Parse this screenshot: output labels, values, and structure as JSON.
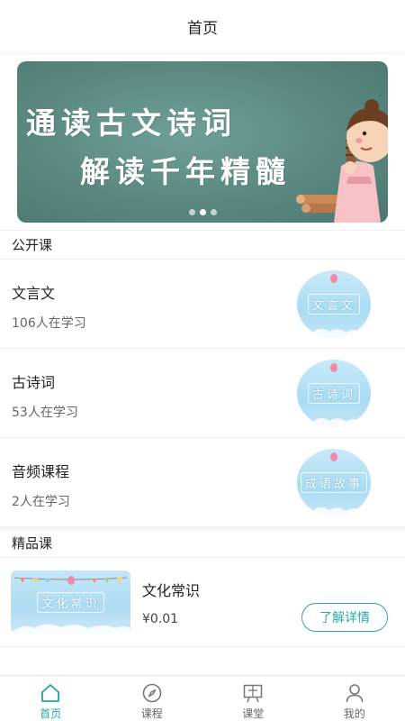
{
  "header": {
    "title": "首页"
  },
  "banner": {
    "line1": "通读古文诗词",
    "line2": "解读千年精髓",
    "dots": 3,
    "active_dot": 1
  },
  "public_section": {
    "title": "公开课"
  },
  "public_courses": [
    {
      "name": "文言文",
      "count": "106人在学习",
      "thumb_text": "文言文"
    },
    {
      "name": "古诗词",
      "count": "53人在学习",
      "thumb_text": "古诗词"
    },
    {
      "name": "音频课程",
      "count": "2人在学习",
      "thumb_text": "成语故事"
    }
  ],
  "premium_section": {
    "title": "精品课"
  },
  "premium_course": {
    "title": "文化常识",
    "price": "¥0.01",
    "thumb_text": "文化常识",
    "button_label": "了解详情"
  },
  "tabbar": {
    "items": [
      {
        "label": "首页",
        "icon": "home-icon",
        "active": true
      },
      {
        "label": "课程",
        "icon": "compass-icon",
        "active": false
      },
      {
        "label": "课堂",
        "icon": "classroom-icon",
        "active": false
      },
      {
        "label": "我的",
        "icon": "user-icon",
        "active": false
      }
    ]
  },
  "colors": {
    "accent": "#2ba9a9",
    "banner_bg": "#5a8881",
    "thumb_bg": "#a9dcf4"
  }
}
